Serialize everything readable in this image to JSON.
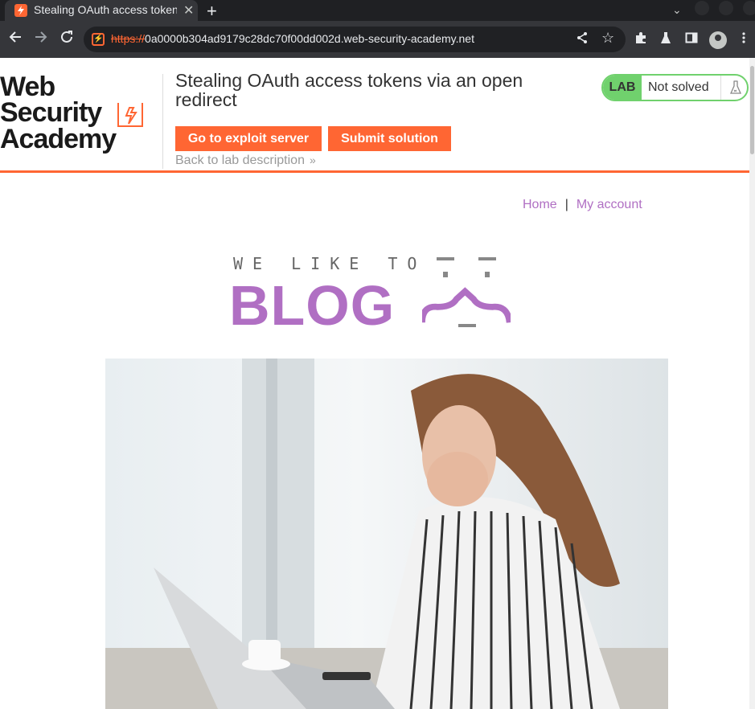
{
  "browser": {
    "tab_title": "Stealing OAuth access tokens via an open redirect",
    "new_tab_label": "+",
    "url_protocol": "https://",
    "url_rest": "0a0000b304ad9179c28dc70f00dd002d.web-security-academy.net"
  },
  "header": {
    "logo_line1": "Web Security",
    "logo_line2": "Academy",
    "lab_title": "Stealing OAuth access tokens via an open redirect",
    "exploit_button": "Go to exploit server",
    "submit_button": "Submit solution",
    "back_link": "Back to lab description",
    "status_badge": "LAB",
    "status_text": "Not solved"
  },
  "nav": {
    "home": "Home",
    "separator": "|",
    "account": "My account"
  },
  "blog_logo": {
    "tagline": "WE LIKE TO",
    "title": "BLOG"
  },
  "colors": {
    "accent": "#ff6633",
    "link": "#b06fc3",
    "solved_status": "#70d16d"
  },
  "icons": [
    "back-arrow-icon",
    "forward-arrow-icon",
    "reload-icon",
    "not-secure-icon",
    "share-icon",
    "star-icon",
    "extensions-icon",
    "flask-icon",
    "sidebar-icon",
    "profile-icon",
    "menu-icon",
    "chevron-right-icon"
  ]
}
